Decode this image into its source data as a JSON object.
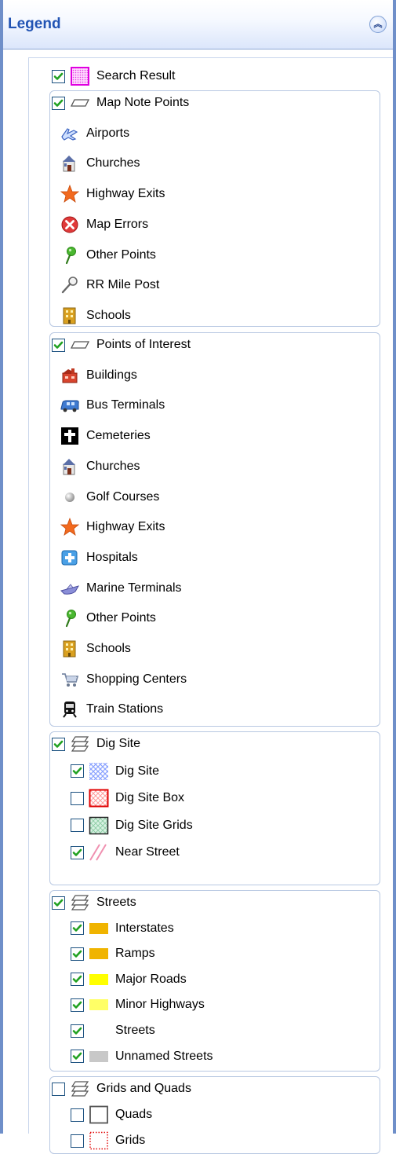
{
  "header": {
    "title": "Legend",
    "collapse_glyph": "︽"
  },
  "colors": {
    "accent": "#2254b4",
    "border": "#6f8fc9",
    "check": "#21a121"
  },
  "search_result": {
    "label": "Search Result",
    "checked": true,
    "icon": "pink-dotted-square"
  },
  "map_note_points": {
    "label": "Map Note Points",
    "checked": true,
    "icon": "layer-parallelogram-icon",
    "items": [
      {
        "label": "Airports",
        "icon": "airport-icon"
      },
      {
        "label": "Churches",
        "icon": "church-icon"
      },
      {
        "label": "Highway Exits",
        "icon": "star-icon"
      },
      {
        "label": "Map Errors",
        "icon": "error-icon"
      },
      {
        "label": "Other Points",
        "icon": "pin-icon"
      },
      {
        "label": "RR Mile Post",
        "icon": "magnifier-post-icon"
      },
      {
        "label": "Schools",
        "icon": "school-icon"
      }
    ]
  },
  "points_of_interest": {
    "label": "Points of Interest",
    "checked": true,
    "icon": "layer-parallelogram-icon",
    "items": [
      {
        "label": "Buildings",
        "icon": "building-icon"
      },
      {
        "label": "Bus Terminals",
        "icon": "bus-icon"
      },
      {
        "label": "Cemeteries",
        "icon": "cross-icon"
      },
      {
        "label": "Churches",
        "icon": "church-icon"
      },
      {
        "label": "Golf Courses",
        "icon": "golf-ball-icon"
      },
      {
        "label": "Highway Exits",
        "icon": "star-icon"
      },
      {
        "label": "Hospitals",
        "icon": "hospital-icon"
      },
      {
        "label": "Marine Terminals",
        "icon": "boat-icon"
      },
      {
        "label": "Other Points",
        "icon": "pin-icon"
      },
      {
        "label": "Schools",
        "icon": "school-icon"
      },
      {
        "label": "Shopping Centers",
        "icon": "cart-icon"
      },
      {
        "label": "Train Stations",
        "icon": "train-icon"
      }
    ]
  },
  "dig_site": {
    "label": "Dig Site",
    "checked": true,
    "icon": "layer-stack-icon",
    "items": [
      {
        "label": "Dig Site",
        "checked": true,
        "icon": "blue-hatch-swatch"
      },
      {
        "label": "Dig Site Box",
        "checked": false,
        "icon": "red-box-swatch"
      },
      {
        "label": "Dig Site Grids",
        "checked": false,
        "icon": "green-grid-swatch"
      },
      {
        "label": "Near Street",
        "checked": true,
        "icon": "pink-diagonal-swatch"
      }
    ]
  },
  "streets": {
    "label": "Streets",
    "checked": true,
    "icon": "layer-stack-icon",
    "items": [
      {
        "label": "Interstates",
        "checked": true,
        "color": "#f0b400"
      },
      {
        "label": "Ramps",
        "checked": true,
        "color": "#f0b400"
      },
      {
        "label": "Major Roads",
        "checked": true,
        "color": "#ffff00"
      },
      {
        "label": "Minor Highways",
        "checked": true,
        "color": "#ffff66"
      },
      {
        "label": "Streets",
        "checked": true,
        "color": "#ffffff"
      },
      {
        "label": "Unnamed Streets",
        "checked": true,
        "color": "#c8c8c8"
      }
    ]
  },
  "grids_and_quads": {
    "label": "Grids and Quads",
    "checked": false,
    "icon": "layer-stack-icon",
    "items": [
      {
        "label": "Quads",
        "checked": false,
        "icon": "gray-square-swatch"
      },
      {
        "label": "Grids",
        "checked": false,
        "icon": "red-dotted-square-swatch"
      }
    ]
  }
}
